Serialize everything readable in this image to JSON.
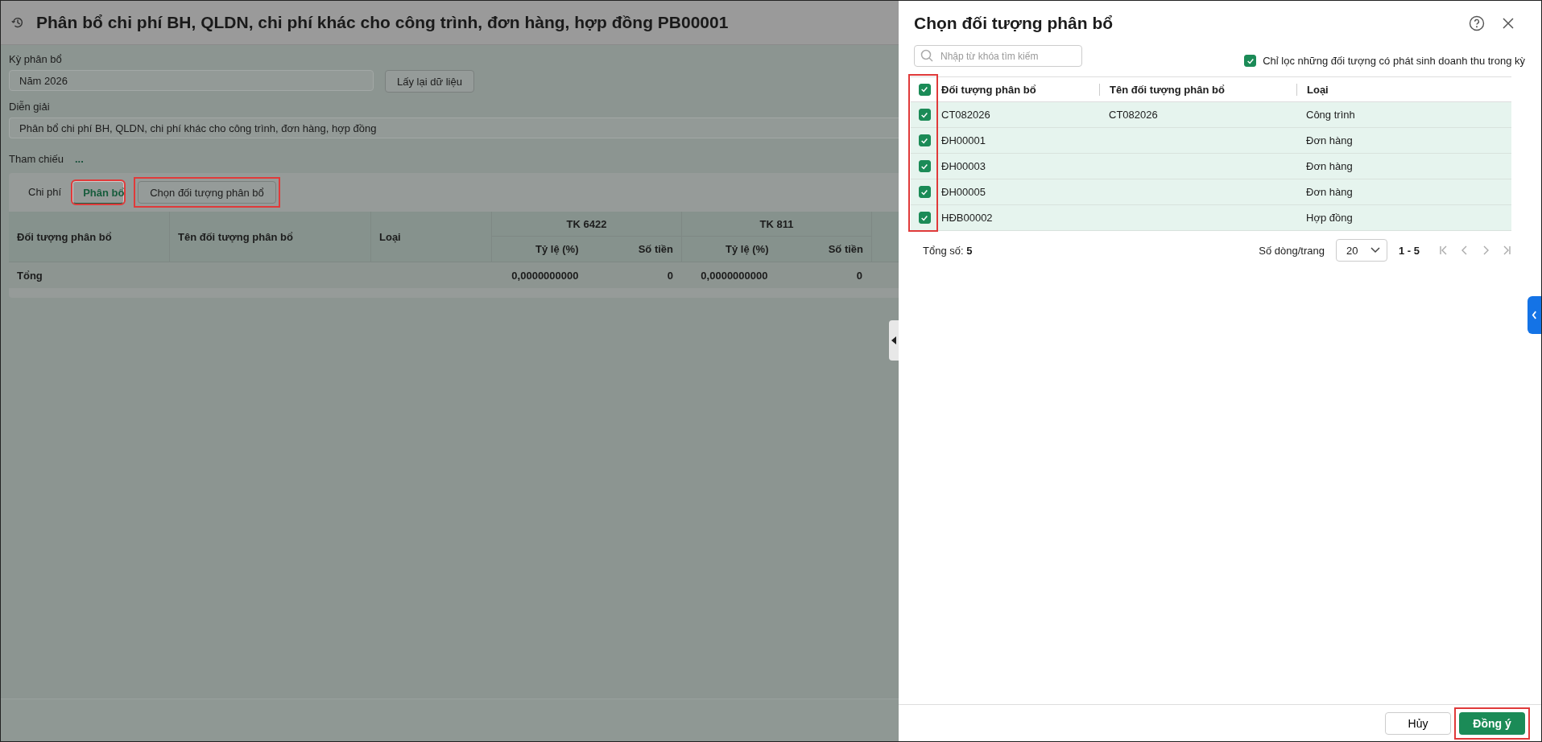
{
  "page": {
    "title": "Phân bổ chi phí BH, QLDN, chi phí khác cho công trình, đơn hàng, hợp đồng PB00001",
    "period": {
      "label": "Kỳ phân bổ",
      "value": "Năm 2026"
    },
    "reload_button": "Lấy lại dữ liệu",
    "description": {
      "label": "Diễn giải",
      "value": "Phân bổ chi phí BH, QLDN, chi phí khác cho công trình, đơn hàng, hợp đồng"
    },
    "reference": {
      "label": "Tham chiếu",
      "value": "..."
    },
    "tabs": [
      {
        "label": "Chi phí",
        "selected": false,
        "highlighted": false
      },
      {
        "label": "Phân bổ",
        "selected": true,
        "highlighted": true
      }
    ],
    "choose_button": {
      "label": "Chọn đối tượng phân bổ",
      "highlighted": true
    },
    "table": {
      "columns": [
        "Đối tượng phân bổ",
        "Tên đối tượng phân bổ",
        "Loại"
      ],
      "groups": [
        {
          "title": "TK 6422",
          "sub": [
            "Tỷ lệ (%)",
            "Số tiền"
          ]
        },
        {
          "title": "TK 811",
          "sub": [
            "Tỷ lệ (%)",
            "Số tiền"
          ]
        }
      ],
      "total": {
        "label": "Tổng",
        "values": [
          "0,0000000000",
          "0",
          "0,0000000000",
          "0"
        ]
      }
    }
  },
  "dialog": {
    "title": "Chọn đối tượng phân bổ",
    "search": {
      "placeholder": "Nhập từ khóa tìm kiếm"
    },
    "filter": {
      "label": "Chỉ lọc những đối tượng có phát sinh doanh thu trong kỳ",
      "checked": true
    },
    "table": {
      "all_checked": true,
      "checkbox_column_highlighted": true,
      "columns": [
        "Đối tượng phân bổ",
        "Tên đối tượng phân bổ",
        "Loại"
      ],
      "rows": [
        {
          "checked": true,
          "code": "CT082026",
          "name": "CT082026",
          "type": "Công trình"
        },
        {
          "checked": true,
          "code": "ĐH00001",
          "name": "",
          "type": "Đơn hàng"
        },
        {
          "checked": true,
          "code": "ĐH00003",
          "name": "",
          "type": "Đơn hàng"
        },
        {
          "checked": true,
          "code": "ĐH00005",
          "name": "",
          "type": "Đơn hàng"
        },
        {
          "checked": true,
          "code": "HĐB00002",
          "name": "",
          "type": "Hợp đồng"
        }
      ]
    },
    "footer": {
      "total_label": "Tổng số:",
      "total": "5",
      "page_size_label": "Số dòng/trang",
      "page_size": "20",
      "range": "1 - 5",
      "nav": [
        {
          "kind": "first",
          "disabled": true
        },
        {
          "kind": "prev",
          "disabled": true
        },
        {
          "kind": "next",
          "disabled": true
        },
        {
          "kind": "last",
          "disabled": true
        }
      ]
    },
    "buttons": [
      {
        "kind": "cancel",
        "label": "Hủy",
        "highlighted": false
      },
      {
        "kind": "ok",
        "label": "Đồng ý",
        "highlighted": true
      }
    ]
  }
}
